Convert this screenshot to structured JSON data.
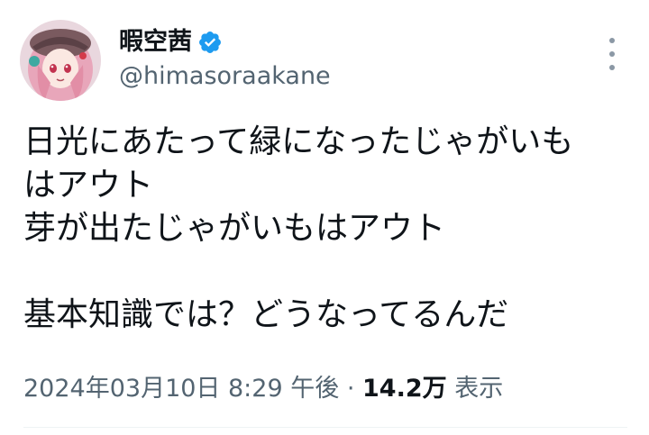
{
  "user": {
    "display_name": "暇空茜",
    "handle": "@himasoraakane",
    "verified": true,
    "verified_color": "#1d9bf0"
  },
  "tweet": {
    "lines": [
      "日光にあたって緑になったじゃがいも",
      "はアウト",
      "芽が出たじゃがいもはアウト",
      "",
      "基本知識では？どうなってるんだ"
    ]
  },
  "meta": {
    "timestamp": "2024年03月10日 8:29 午後",
    "separator": "·",
    "views_count": "14.2万",
    "views_label": "表示"
  },
  "icons": {
    "avatar": "avatar-image",
    "verified": "verified-badge-icon",
    "more": "more-options-icon"
  }
}
